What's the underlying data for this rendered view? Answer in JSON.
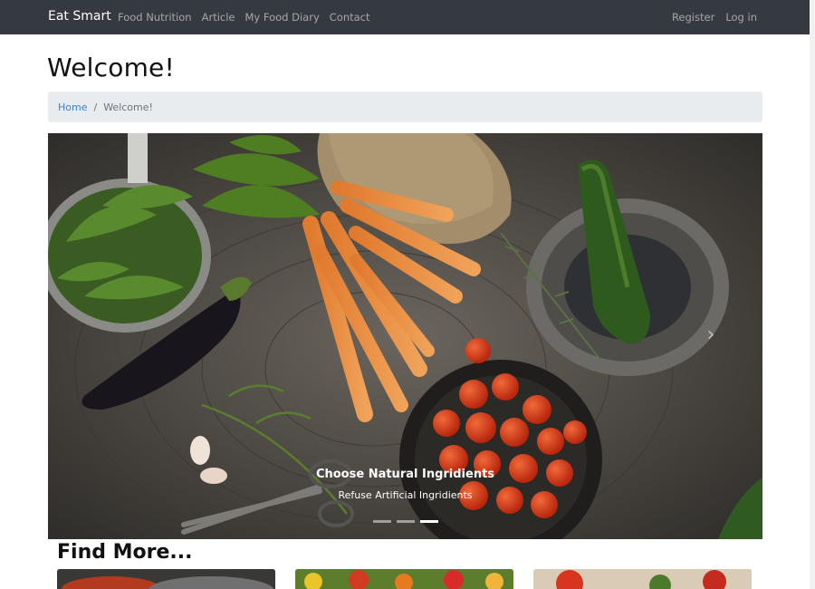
{
  "navbar": {
    "brand": "Eat Smart",
    "left_links": [
      "Food Nutrition",
      "Article",
      "My Food Diary",
      "Contact"
    ],
    "right_links": [
      "Register",
      "Log in"
    ]
  },
  "page": {
    "title": "Welcome!"
  },
  "breadcrumb": {
    "home": "Home",
    "current": "Welcome!"
  },
  "carousel": {
    "caption_title": "Choose Natural Ingridients",
    "caption_text": "Refuse Artificial Ingridients",
    "slides_count": 3,
    "active_slide": 3
  },
  "find_more": {
    "heading": "Find More..."
  },
  "icons": {
    "next": "chevron-right-icon"
  },
  "colors": {
    "navbar": "#343a40",
    "link": "#3b7ddd",
    "breadcrumb_bg": "#e9ecef"
  }
}
